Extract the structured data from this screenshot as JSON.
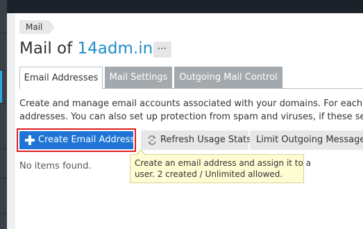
{
  "breadcrumb": {
    "label": "Mail"
  },
  "page": {
    "title_prefix": "Mail of",
    "domain": "14adm.in",
    "more_label": "⋯"
  },
  "tabs": [
    {
      "label": "Email Addresses",
      "active": true
    },
    {
      "label": "Mail Settings",
      "active": false
    },
    {
      "label": "Outgoing Mail Control",
      "active": false
    }
  ],
  "description": {
    "line1": "Create and manage email accounts associated with your domains. For each email",
    "line2": "addresses. You can also set up protection from spam and viruses, if these services"
  },
  "toolbar": {
    "create_label": "Create Email Address",
    "refresh_label": "Refresh Usage Stats",
    "limit_label": "Limit Outgoing Messages"
  },
  "list": {
    "empty_text": "No items found."
  },
  "tooltip": {
    "line1": "Create an email address and assign it to a",
    "line2": "user. 2 created / Unlimited allowed."
  },
  "colors": {
    "accent": "#1e8cc8",
    "primary_button": "#1f74d6",
    "focus_ring": "#e01b1b",
    "tooltip_bg": "#fdfcd2",
    "inactive_tab": "#a3a9ad"
  }
}
